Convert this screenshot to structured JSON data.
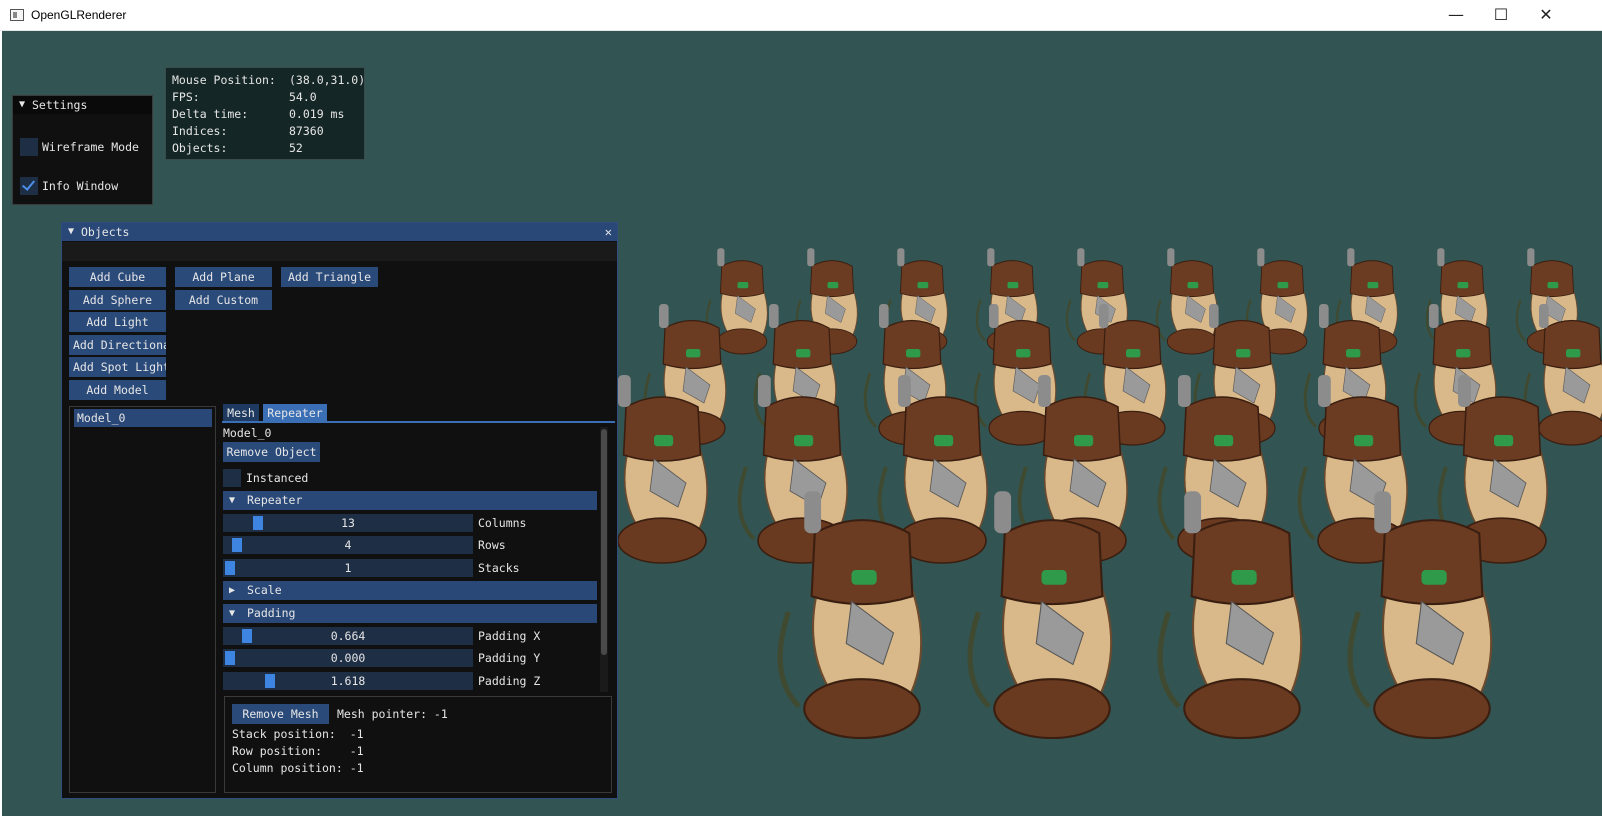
{
  "window": {
    "title": "OpenGLRenderer",
    "minimize": "—",
    "maximize": "☐",
    "close": "✕"
  },
  "colors": {
    "viewport_bg": "#325553",
    "panel_bg": "#101010",
    "button": "#2a4a7a",
    "header": "#294877",
    "accent": "#3d85e0"
  },
  "settings": {
    "title": "Settings",
    "wireframe": {
      "label": "Wireframe Mode",
      "checked": false
    },
    "info_window": {
      "label": "Info Window",
      "checked": true
    }
  },
  "info": {
    "rows": [
      {
        "key": "Mouse Position:",
        "value": "(38.0,31.0)"
      },
      {
        "key": "FPS:",
        "value": "54.0"
      },
      {
        "key": "Delta time:",
        "value": "0.019 ms"
      },
      {
        "key": "Indices:",
        "value": "87360"
      },
      {
        "key": "Objects:",
        "value": "52"
      }
    ]
  },
  "objects": {
    "title": "Objects",
    "buttons": {
      "add_cube": "Add Cube",
      "add_plane": "Add Plane",
      "add_triangle": "Add Triangle",
      "add_sphere": "Add Sphere",
      "add_custom": "Add Custom",
      "add_light": "Add Light",
      "add_directional": "Add Directiona",
      "add_spot_light": "Add Spot Light",
      "add_model": "Add Model"
    },
    "list": [
      "Model_0"
    ],
    "tabs": {
      "mesh": "Mesh",
      "repeater": "Repeater"
    },
    "selected_name": "Model_0",
    "remove_object": "Remove Object",
    "instanced": {
      "label": "Instanced",
      "checked": false
    },
    "repeater_header": "Repeater",
    "scale_header": "Scale",
    "padding_header": "Padding",
    "sliders": {
      "columns": {
        "value": "13",
        "label": "Columns",
        "fraction": 0.12
      },
      "rows": {
        "value": "4",
        "label": "Rows",
        "fraction": 0.03
      },
      "stacks": {
        "value": "1",
        "label": "Stacks",
        "fraction": 0.0
      },
      "padding_x": {
        "value": "0.664",
        "label": "Padding X",
        "fraction": 0.07
      },
      "padding_y": {
        "value": "0.000",
        "label": "Padding Y",
        "fraction": 0.0
      },
      "padding_z": {
        "value": "1.618",
        "label": "Padding Z",
        "fraction": 0.17
      }
    },
    "mesh_info": {
      "remove_mesh": "Remove Mesh",
      "mesh_pointer": "Mesh pointer: -1",
      "stack_position": "Stack position:  -1",
      "row_position": "Row position:    -1",
      "column_position": "Column position: -1"
    }
  }
}
